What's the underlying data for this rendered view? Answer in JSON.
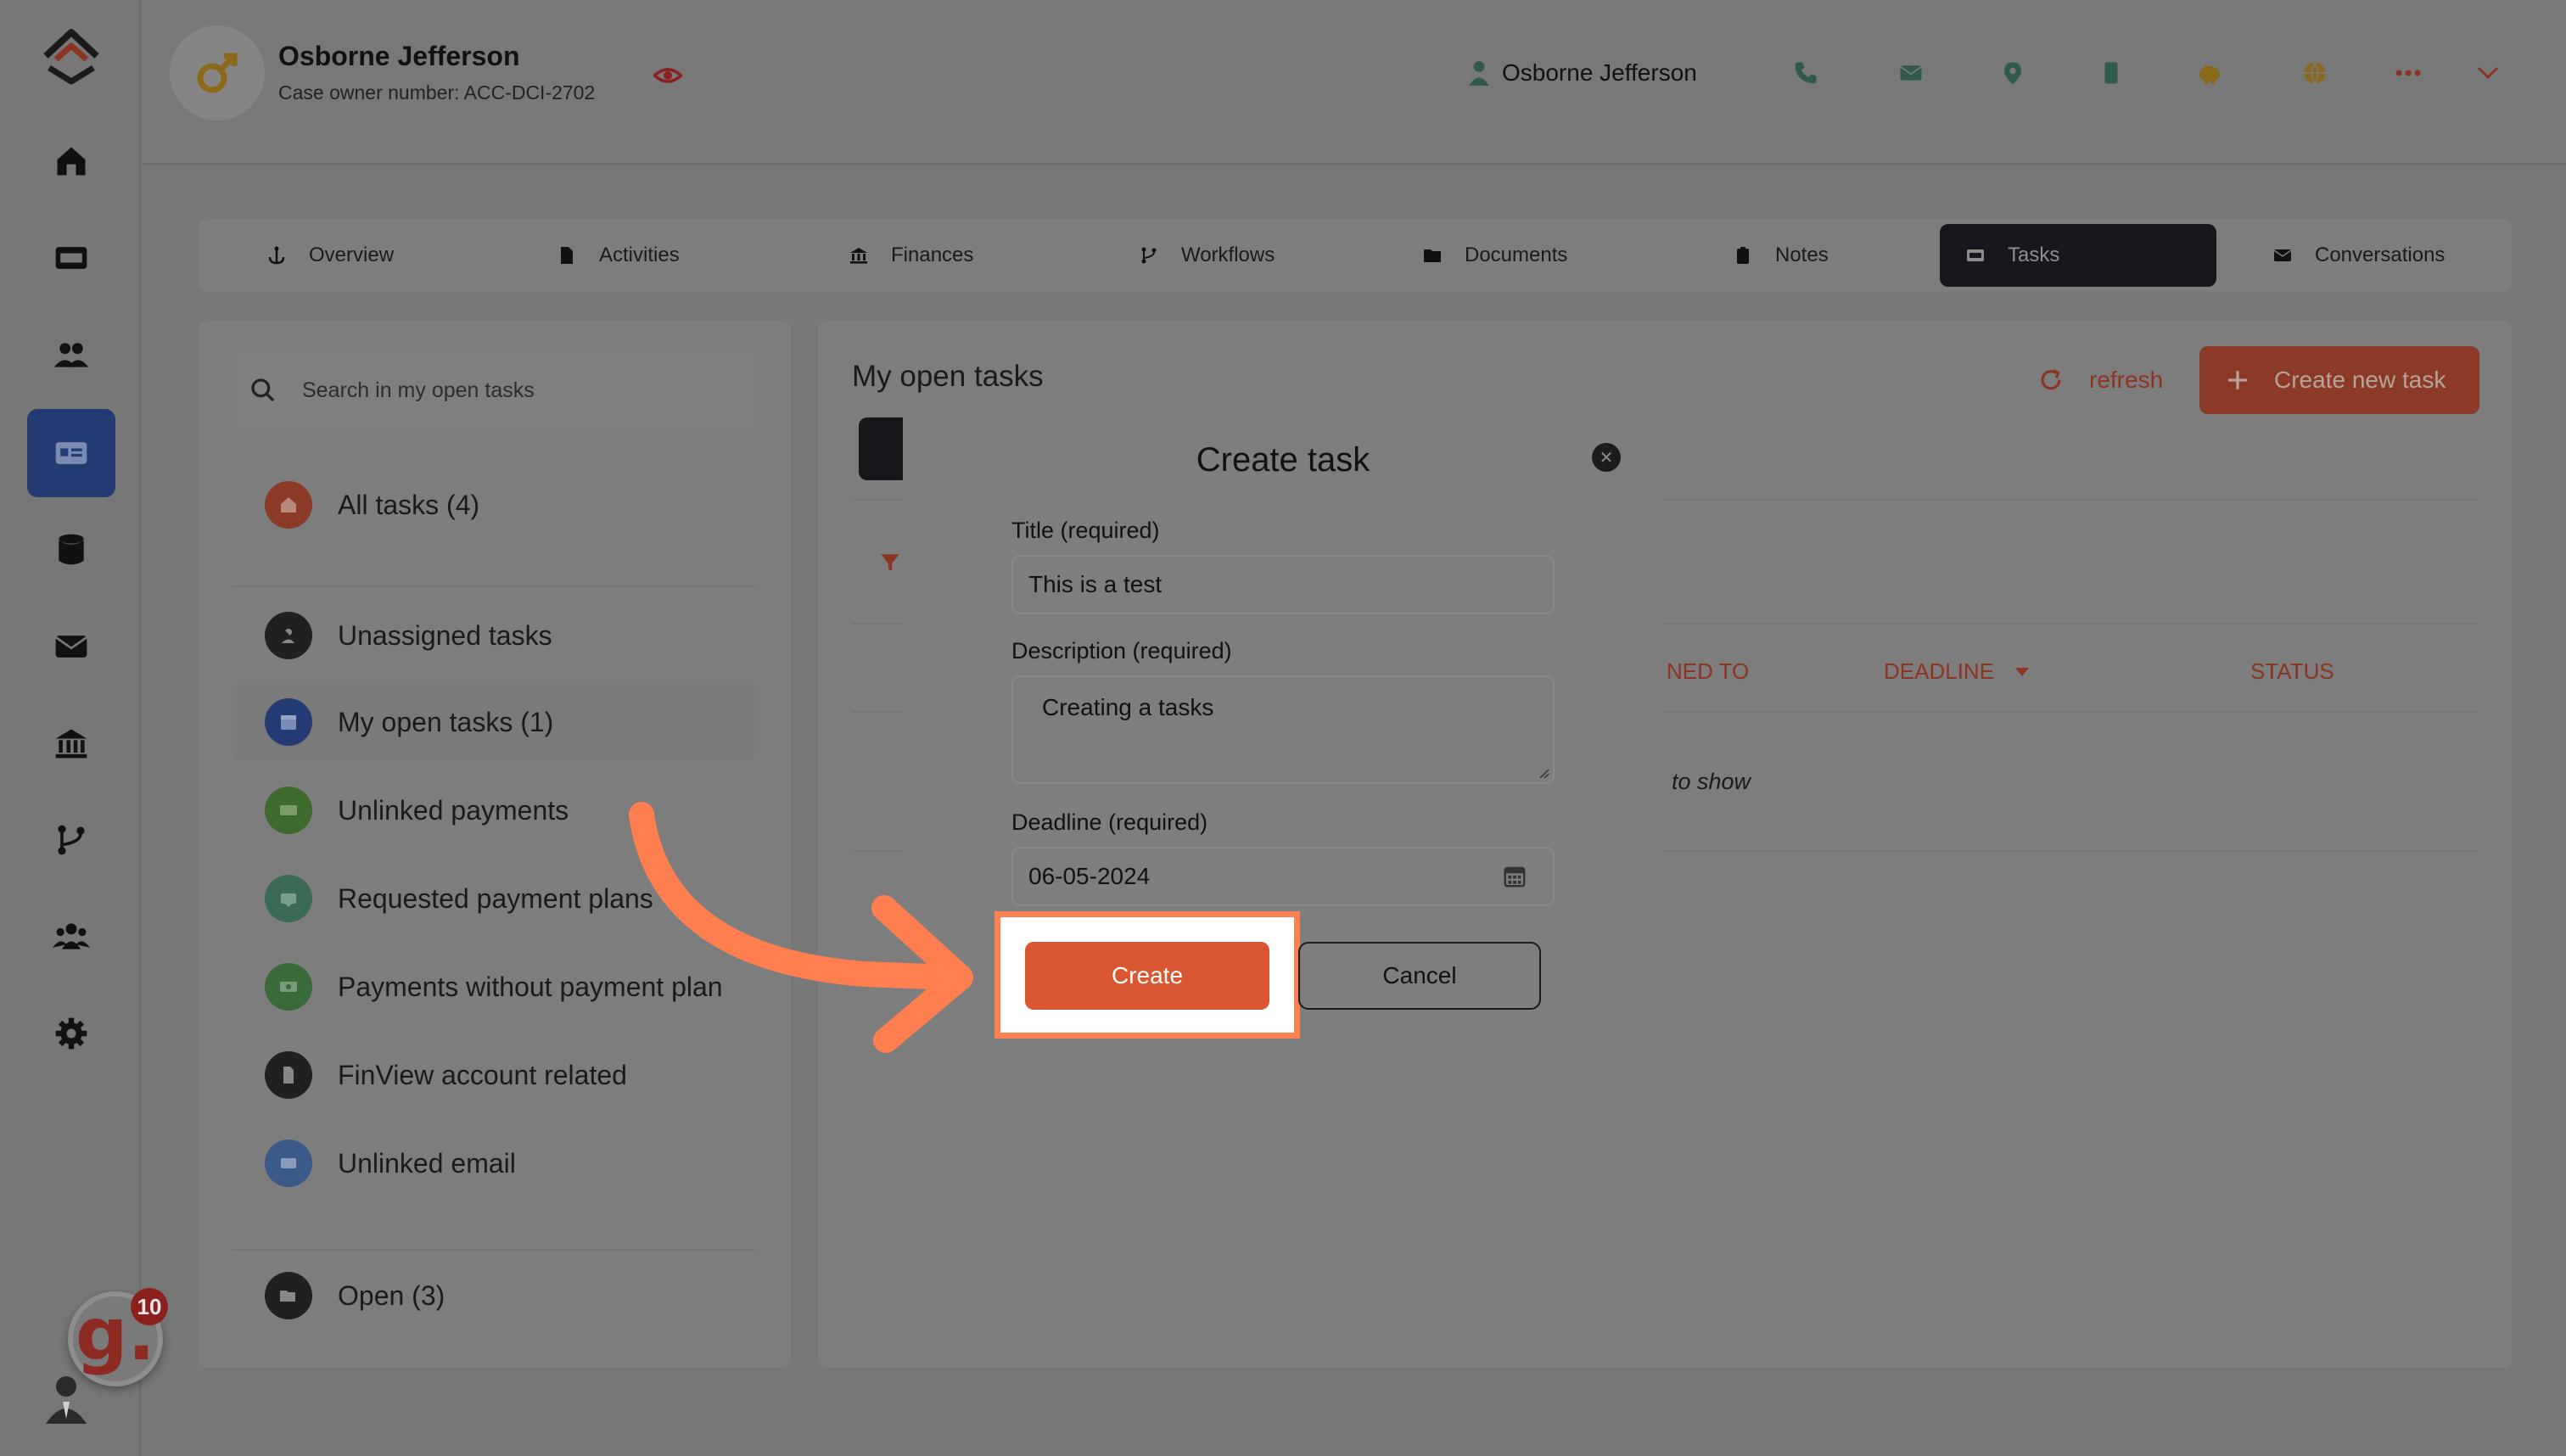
{
  "rail": {
    "items": [
      "home",
      "dashboard",
      "people",
      "cases",
      "database",
      "mail",
      "bank",
      "workflows",
      "teams",
      "settings"
    ],
    "active_index": 3,
    "notification_count": "10",
    "brand_letter": "g."
  },
  "header": {
    "owner_name": "Osborne Jefferson",
    "owner_sub": "Case owner number: ACC-DCI-2702",
    "user_name": "Osborne Jefferson"
  },
  "tabs": [
    {
      "label": "Overview"
    },
    {
      "label": "Activities"
    },
    {
      "label": "Finances"
    },
    {
      "label": "Workflows"
    },
    {
      "label": "Documents"
    },
    {
      "label": "Notes"
    },
    {
      "label": "Tasks"
    },
    {
      "label": "Conversations"
    }
  ],
  "left_panel": {
    "search_placeholder": "Search in my open tasks",
    "items": [
      {
        "label": "All tasks (4)",
        "color": "#8a3a26"
      },
      {
        "label": "Unassigned tasks",
        "color": "#202020"
      },
      {
        "label": "My open tasks (1)",
        "color": "#243a73"
      },
      {
        "label": "Unlinked payments",
        "color": "#3f6a2e"
      },
      {
        "label": "Requested payment plans",
        "color": "#3b6b55"
      },
      {
        "label": "Payments without payment plan",
        "color": "#3b6a3a"
      },
      {
        "label": "FinView account related",
        "color": "#202020"
      },
      {
        "label": "Unlinked email",
        "color": "#3b5a8a"
      },
      {
        "label": "Open (3)",
        "color": "#202020"
      }
    ]
  },
  "main": {
    "title": "My open tasks",
    "refresh_label": "refresh",
    "create_new_label": "Create new task",
    "columns": {
      "assigned_partial": "NED TO",
      "deadline": "DEADLINE",
      "status": "STATUS"
    },
    "empty_partial": "to show"
  },
  "modal": {
    "title": "Create task",
    "title_label": "Title (required)",
    "title_value": "This is a test",
    "description_label": "Description (required)",
    "description_value": "Creating a tasks",
    "deadline_label": "Deadline (required)",
    "deadline_value": "06-05-2024",
    "create_label": "Create",
    "cancel_label": "Cancel"
  },
  "colors": {
    "accent": "#d85632",
    "highlight_border": "#ff7f50",
    "active_tab": "#16181d"
  }
}
